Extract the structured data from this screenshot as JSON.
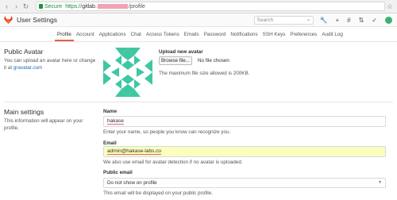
{
  "browser": {
    "secure_label": "Secure",
    "url_proto": "https://",
    "url_host": "gitlab.",
    "url_path": "/profile"
  },
  "header": {
    "title": "User Settings",
    "search_placeholder": "Search"
  },
  "tabs": [
    {
      "label": "Profile",
      "active": true
    },
    {
      "label": "Account"
    },
    {
      "label": "Applications"
    },
    {
      "label": "Chat"
    },
    {
      "label": "Access Tokens"
    },
    {
      "label": "Emails"
    },
    {
      "label": "Password"
    },
    {
      "label": "Notifications"
    },
    {
      "label": "SSH Keys"
    },
    {
      "label": "Preferences"
    },
    {
      "label": "Audit Log"
    }
  ],
  "public_avatar": {
    "title": "Public Avatar",
    "desc_prefix": "You can upload an avatar here or change it at ",
    "desc_link": "gravatar.com",
    "upload_label": "Upload new avatar",
    "browse_label": "Browse file...",
    "no_file": "No file chosen",
    "max_size": "The maximum file size allowed is 200KB."
  },
  "main_settings": {
    "title": "Main settings",
    "desc": "This information will appear on your profile.",
    "name_label": "Name",
    "name_value": "hakase",
    "name_help": "Enter your name, so people you know can recognize you.",
    "email_label": "Email",
    "email_value": "admin@hakase-labs.co",
    "email_help": "We also use email for avatar detection if no avatar is uploaded.",
    "public_email_label": "Public email",
    "public_email_value": "Do not show on profile",
    "public_email_help": "This email will be displayed on your public profile."
  },
  "colors": {
    "accent": "#e75e40",
    "identicon": "#3ec7a2",
    "autofill": "#faffbd"
  }
}
